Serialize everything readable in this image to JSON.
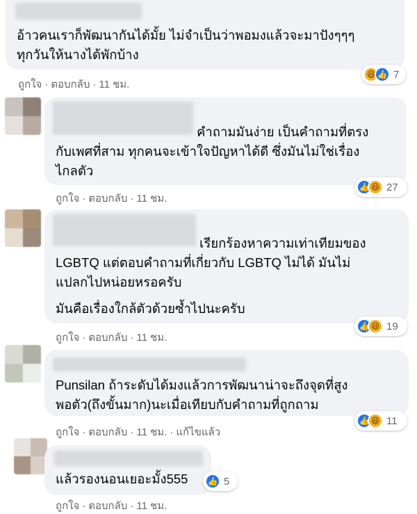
{
  "comments": [
    {
      "text_lines": [
        "อ้าวคนเราก็พัฒนากันได้มั้ย ไม่จำเป็นว่าพอมงแล้วจะมาปังๆๆๆ",
        "ทุกวันให้นางได้พักบ้าง"
      ],
      "actions": {
        "like": "ถูกใจ",
        "reply": "ตอบกลับ",
        "time": "11 ชม."
      },
      "reactions": {
        "icons": [
          "haha-icon",
          "like-icon"
        ],
        "count": "7"
      }
    },
    {
      "text_lines": [
        "คำถามมันง่าย เป็นคำถามที่ตรง",
        "กับเพศที่สาม ทุกคนจะเข้าใจปัญหาได้ดี ซึ่งมันไม่ใช่เรื่อง",
        "ไกลตัว"
      ],
      "actions": {
        "like": "ถูกใจ",
        "reply": "ตอบกลับ",
        "time": "11 ชม."
      },
      "reactions": {
        "icons": [
          "like-icon",
          "haha-icon"
        ],
        "count": "27"
      }
    },
    {
      "text_lines": [
        "เรียกร้องหาความเท่าเทียมของ",
        "LGBTQ แต่ตอบคำถามที่เกี่ยวกับ LGBTQ ไม่ได้ มันไม่",
        "แปลกไปหน่อยหรอครับ",
        "มันคือเรื่องใกล้ตัวด้วยซ้ำไปนะครับ"
      ],
      "actions": {
        "like": "ถูกใจ",
        "reply": "ตอบกลับ",
        "time": "11 ชม."
      },
      "reactions": {
        "icons": [
          "like-icon",
          "haha-icon"
        ],
        "count": "19"
      }
    },
    {
      "text_lines": [
        "Punsilan ถ้าระดับได้มงแล้วการพัฒนาน่าจะถึงจุดที่สูง",
        "พอตัว(ถึงขั้นมาก)นะเมื่อเทียบกับคำถามที่ถูกถาม"
      ],
      "actions": {
        "like": "ถูกใจ",
        "reply": "ตอบกลับ",
        "time": "11 ชม.",
        "edited": "แก้ไขแล้ว"
      },
      "reactions": {
        "icons": [
          "like-icon",
          "haha-icon"
        ],
        "count": "11"
      }
    },
    {
      "text_lines": [
        "แล้วรองนอนเยอะมั้ง555"
      ],
      "actions": {
        "like": "ถูกใจ",
        "reply": "ตอบกลับ",
        "time": "11 ชม."
      },
      "reactions": {
        "icons": [
          "like-icon"
        ],
        "count": "5"
      }
    }
  ],
  "colors": {
    "bubble": "#f0f2f5",
    "meta_text": "#65676b",
    "like_blue": "#1877f2",
    "haha_yellow": "#f7b125"
  }
}
